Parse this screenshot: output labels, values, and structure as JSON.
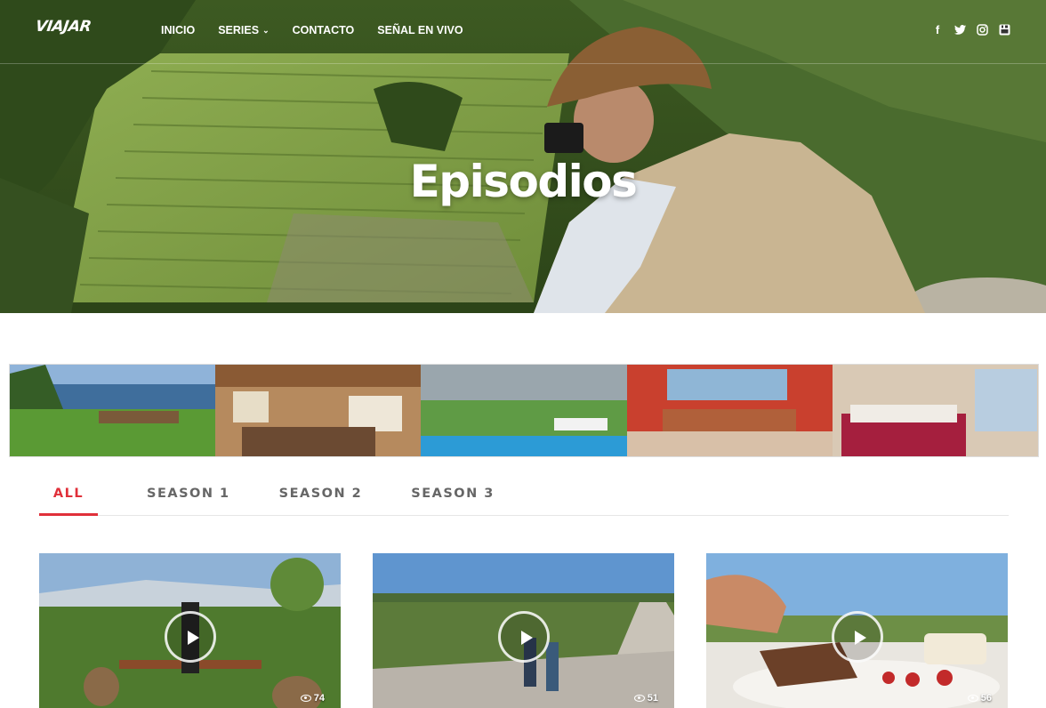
{
  "header": {
    "logo": "VIAJAR",
    "nav": [
      {
        "label": "INICIO"
      },
      {
        "label": "SERIES",
        "dropdown": true
      },
      {
        "label": "CONTACTO"
      },
      {
        "label": "SEÑAL EN VIVO"
      }
    ],
    "social": [
      {
        "icon": "facebook-icon",
        "glyph": "f"
      },
      {
        "icon": "twitter-icon",
        "glyph": "t"
      },
      {
        "icon": "instagram-icon",
        "glyph": "◎"
      },
      {
        "icon": "youtube-icon",
        "glyph": "▣"
      }
    ]
  },
  "hero": {
    "title": "Episodios"
  },
  "tabs": [
    {
      "label": "ALL",
      "active": true
    },
    {
      "label": "SEASON 1",
      "active": false
    },
    {
      "label": "SEASON 2",
      "active": false
    },
    {
      "label": "SEASON 3",
      "active": false
    }
  ],
  "episodes": [
    {
      "views": "74"
    },
    {
      "views": "51"
    },
    {
      "views": "56"
    }
  ],
  "colors": {
    "accent": "#e0303a",
    "tab_text": "#666666"
  }
}
